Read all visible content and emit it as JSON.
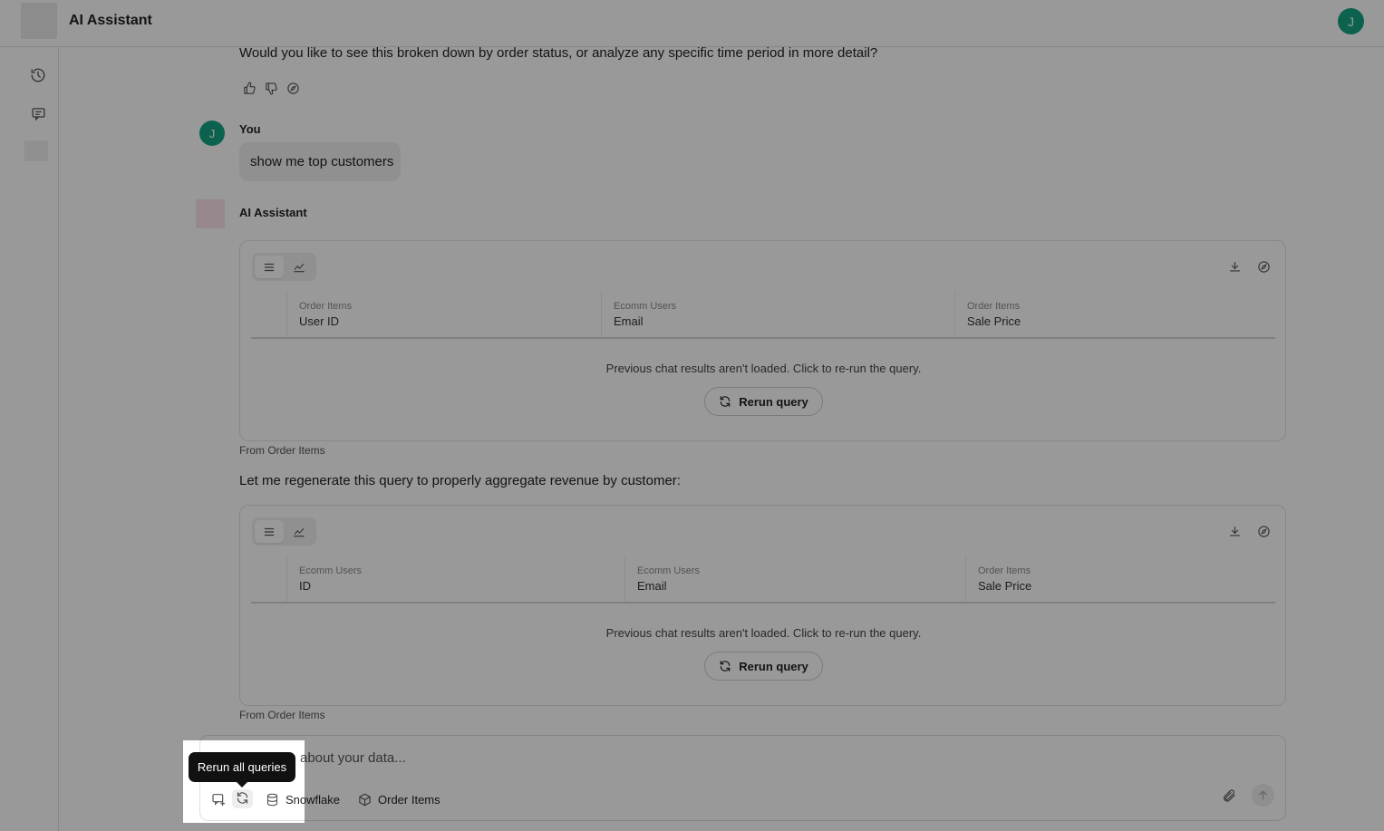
{
  "header": {
    "title": "AI Assistant",
    "user_initial": "J"
  },
  "sidebar": {
    "items": [
      {
        "icon": "history-icon"
      },
      {
        "icon": "new-chat-icon"
      }
    ]
  },
  "chat": {
    "prev_followup": "Would you like to see this broken down by order status, or analyze any specific time period in more detail?",
    "user": {
      "name": "You",
      "initial": "J",
      "message": "show me top customers"
    },
    "assistant": {
      "name": "AI Assistant"
    },
    "results": [
      {
        "columns": [
          {
            "group": "Order Items",
            "field": "User ID"
          },
          {
            "group": "Ecomm Users",
            "field": "Email"
          },
          {
            "group": "Order Items",
            "field": "Sale Price"
          }
        ],
        "empty_message": "Previous chat results aren't loaded. Click to re-run the query.",
        "rerun_label": "Rerun query",
        "source": "From Order Items"
      },
      {
        "columns": [
          {
            "group": "Ecomm Users",
            "field": "ID"
          },
          {
            "group": "Ecomm Users",
            "field": "Email"
          },
          {
            "group": "Order Items",
            "field": "Sale Price"
          }
        ],
        "empty_message": "Previous chat results aren't loaded. Click to re-run the query.",
        "rerun_label": "Rerun query",
        "source": "From Order Items"
      }
    ],
    "between_text": "Let me regenerate this query to properly aggregate revenue by customer:"
  },
  "composer": {
    "placeholder_visible": "about your data...",
    "datasource": "Snowflake",
    "model": "Order Items",
    "tooltip": "Rerun all queries"
  },
  "colors": {
    "accent": "#14a383",
    "overlay": "rgba(0,0,0,0.4)"
  }
}
